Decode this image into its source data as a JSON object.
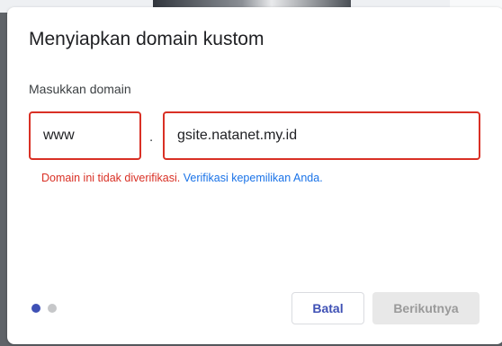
{
  "dialog": {
    "title": "Menyiapkan domain kustom",
    "field_label": "Masukkan domain",
    "subdomain_value": "www",
    "separator": ".",
    "domain_value": "gsite.natanet.my.id",
    "error_text": "Domain ini tidak diverifikasi.",
    "error_link": "Verifikasi kepemilikan Anda.",
    "pager": {
      "total": 2,
      "active_index": 0
    },
    "buttons": {
      "cancel": "Batal",
      "next": "Berikutnya"
    }
  },
  "colors": {
    "error": "#d93025",
    "link": "#1a73e8",
    "accent": "#3f51b5",
    "disabled_button_bg": "#e8e8e8",
    "disabled_button_text": "#9a9a9a"
  }
}
